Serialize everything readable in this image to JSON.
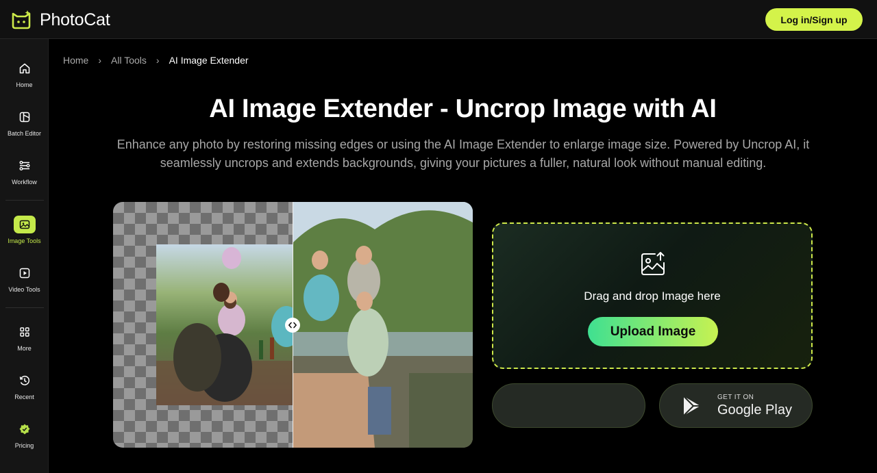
{
  "app": {
    "name": "PhotoCat",
    "accent": "#d4f34a"
  },
  "header": {
    "login_label": "Log in/Sign up"
  },
  "sidebar": {
    "items": [
      {
        "label": "Home",
        "icon": "home-icon"
      },
      {
        "label": "Batch Editor",
        "icon": "batch-icon"
      },
      {
        "label": "Workflow",
        "icon": "workflow-icon"
      },
      {
        "label": "Image Tools",
        "icon": "image-icon",
        "active": true
      },
      {
        "label": "Video Tools",
        "icon": "video-icon"
      },
      {
        "label": "More",
        "icon": "grid-icon"
      },
      {
        "label": "Recent",
        "icon": "history-icon"
      },
      {
        "label": "Pricing",
        "icon": "badge-icon"
      }
    ]
  },
  "breadcrumb": [
    "Home",
    "All Tools",
    "AI Image Extender"
  ],
  "hero": {
    "title": "AI Image Extender - Uncrop Image with AI",
    "description": "Enhance any photo by restoring missing edges or using the AI Image Extender to enlarge image size. Powered by Uncrop AI, it seamlessly uncrops and extends backgrounds, giving your pictures a fuller, natural look without manual editing."
  },
  "upload": {
    "prompt": "Drag and drop Image here",
    "button_label": "Upload Image"
  },
  "stores": {
    "google_small": "GET IT ON",
    "google_big": "Google Play"
  }
}
